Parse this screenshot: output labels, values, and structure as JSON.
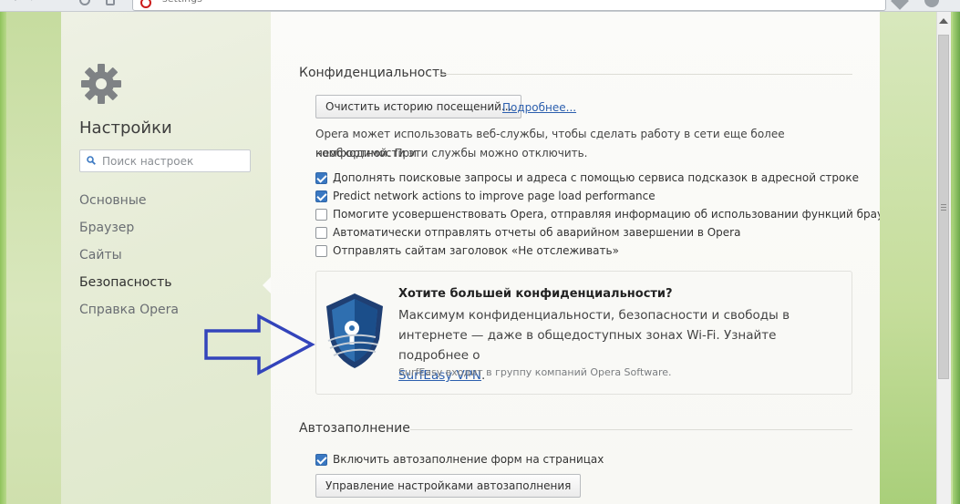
{
  "browser": {
    "address_text": "settings"
  },
  "sidebar": {
    "title": "Настройки",
    "search_placeholder": "Поиск настроек",
    "items": [
      {
        "label": "Основные",
        "active": false
      },
      {
        "label": "Браузер",
        "active": false
      },
      {
        "label": "Сайты",
        "active": false
      },
      {
        "label": "Безопасность",
        "active": true
      },
      {
        "label": "Справка Opera",
        "active": false
      }
    ]
  },
  "privacy": {
    "title": "Конфиденциальность",
    "clear_button": "Очистить историю посещений...",
    "more_link": "Подробнее...",
    "description_line1": "Opera может использовать веб-службы, чтобы сделать работу в сети еще более комфортной. При",
    "description_line2": "необходимости эти службы можно отключить.",
    "checkboxes": [
      {
        "label": "Дополнять поисковые запросы и адреса с помощью сервиса подсказок в адресной строке",
        "checked": true
      },
      {
        "label": "Predict network actions to improve page load performance",
        "checked": true
      },
      {
        "label": "Помогите усовершенствовать Opera, отправляя информацию об использовании функций браузера",
        "checked": false
      },
      {
        "label": "Автоматически отправлять отчеты об аварийном завершении в Opera",
        "checked": false
      },
      {
        "label": "Отправлять сайтам заголовок «Не отслеживать»",
        "checked": false
      }
    ]
  },
  "promo": {
    "title": "Хотите большей конфиденциальности?",
    "text_line1": "Максимум конфиденциальности, безопасности и свободы в",
    "text_line2": "интернете — даже в общедоступных зонах Wi-Fi. Узнайте подробнее о",
    "link": "SurfEasy VPN",
    "link_suffix": ".",
    "small_text": "SurfEasy входит в группу компаний Opera Software."
  },
  "autofill": {
    "title": "Автозаполнение",
    "checkbox_label": "Включить автозаполнение форм на страницах",
    "checkbox_checked": true,
    "manage_button": "Управление настройками автозаполнения"
  },
  "colors": {
    "accent": "#3a78c2",
    "link": "#2c5fae",
    "annotation_arrow": "#3344bb"
  }
}
